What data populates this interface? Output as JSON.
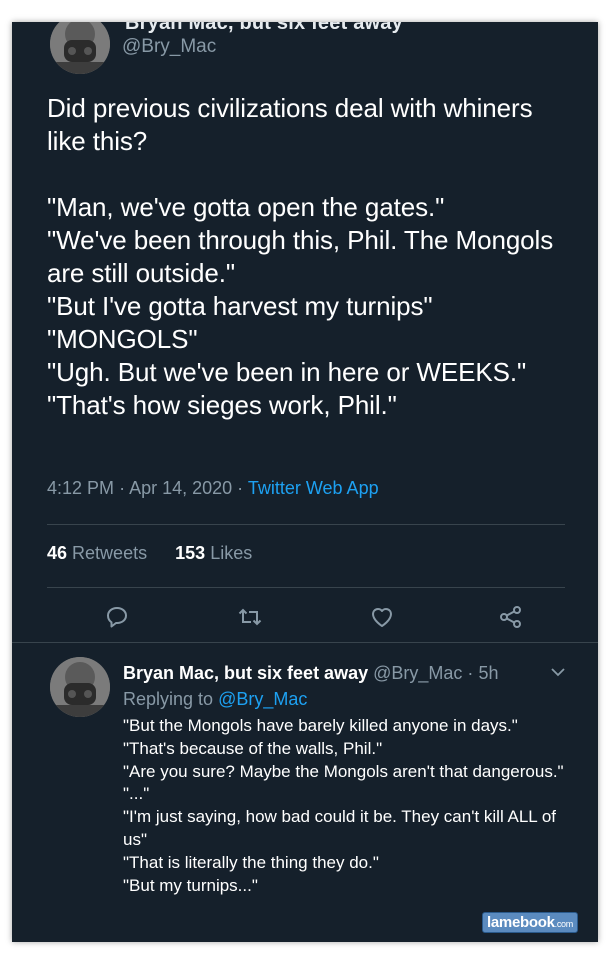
{
  "tweet": {
    "display_name": "Bryan Mac, but six feet away",
    "handle": "@Bry_Mac",
    "text": "Did previous civilizations deal with whiners like this?\n\n\"Man, we've gotta open the gates.\"\n\"We've been through this, Phil. The Mongols are still outside.\"\n\"But I've gotta harvest my turnips\"\n\"MONGOLS\"\n\"Ugh. But we've been in here or WEEKS.\"\n\"That's how sieges work, Phil.\"",
    "time": "4:12 PM",
    "date": "Apr 14, 2020",
    "separator": "·",
    "source_app": "Twitter Web App",
    "retweets_count": "46",
    "retweets_label": "Retweets",
    "likes_count": "153",
    "likes_label": "Likes"
  },
  "actions": {
    "reply_icon": "reply-icon",
    "retweet_icon": "retweet-icon",
    "like_icon": "heart-icon",
    "share_icon": "share-icon"
  },
  "reply": {
    "display_name": "Bryan Mac, but six feet away",
    "handle": "@Bry_Mac",
    "separator": "·",
    "time": "5h",
    "replying_label": "Replying to",
    "replying_to": "@Bry_Mac",
    "text": "\"But the Mongols have barely killed anyone in days.\"\n\"That's because of the walls, Phil.\"\n\"Are you sure? Maybe the Mongols aren't that dangerous.\"\n\"...\"\n\"I'm just saying, how bad could it be. They can't kill ALL of us\"\n\"That is literally the thing they do.\"\n\"But my turnips...\""
  },
  "watermark": {
    "text": "lamebook",
    "suffix": ".com"
  },
  "colors": {
    "background": "#15202b",
    "text": "#ffffff",
    "secondary": "#8899a6",
    "link": "#1da1f2",
    "divider": "#38444d"
  }
}
